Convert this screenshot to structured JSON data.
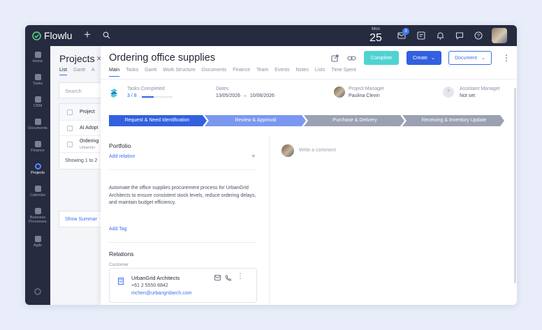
{
  "app": {
    "name": "Flowlu"
  },
  "topbar": {
    "date_month": "Mon",
    "date_day": "25",
    "notification_count": "3"
  },
  "sidebar": {
    "items": [
      {
        "label": "Home",
        "icon": "home-icon"
      },
      {
        "label": "Tasks",
        "icon": "tasks-icon"
      },
      {
        "label": "CRM",
        "icon": "crm-icon"
      },
      {
        "label": "Documents",
        "icon": "documents-icon"
      },
      {
        "label": "Finance",
        "icon": "finance-icon"
      },
      {
        "label": "Projects",
        "icon": "projects-icon"
      },
      {
        "label": "Calendar",
        "icon": "calendar-icon"
      },
      {
        "label": "Business Processes",
        "icon": "business-processes-icon"
      },
      {
        "label": "Agile",
        "icon": "agile-icon"
      }
    ]
  },
  "projects_panel": {
    "title": "Projects",
    "tabs": [
      "List",
      "Gantt",
      "A"
    ],
    "search_placeholder": "Search",
    "column_header": "Project",
    "rows": [
      {
        "name": "AI Adopt",
        "sub": ""
      },
      {
        "name": "Ordering",
        "sub": "UrbanGri"
      }
    ],
    "footer": "Showing 1 to 2",
    "show_summary": "Show Summar"
  },
  "project": {
    "title": "Ordering office supplies",
    "buttons": {
      "complete": "Complete",
      "create": "Create",
      "document": "Document"
    },
    "tabs": [
      "Main",
      "Tasks",
      "Gantt",
      "Work Structure",
      "Documents",
      "Finance",
      "Team",
      "Events",
      "Notes",
      "Lists",
      "Time Spent"
    ],
    "stats": {
      "tasks_label": "Tasks Completed",
      "tasks_value": "3 / 8",
      "tasks_progress": 0.375,
      "dates_label": "Dates",
      "dates_start": "13/05/2026",
      "dates_sep": "–",
      "dates_end": "10/06/2026",
      "pm_label": "Project Manager",
      "pm_value": "Paulina Clevin",
      "am_label": "Assistant Manager",
      "am_value": "Not set"
    },
    "stages": [
      {
        "label": "Request & Need Identification",
        "color": "#3260e0"
      },
      {
        "label": "Review & Approval",
        "color": "#7a98f0"
      },
      {
        "label": "Purchase & Delivery",
        "color": "#9aa1b2"
      },
      {
        "label": "Receiving & Inventory Update",
        "color": "#9aa1b2"
      }
    ],
    "portfolio_title": "Portfolio",
    "add_relation": "Add relation",
    "description": "Automate the office supplies procurement process for UrbanGrid Architects to ensure consistent stock levels, reduce ordering delays, and maintain budget efficiency.",
    "add_tag": "Add Tag",
    "relations_title": "Relations",
    "customer_label": "Customer",
    "customer": {
      "name": "UrbanGrid Architects",
      "phone": "+61 2 5550 8842",
      "email": "mchen@urbangridarch.com"
    },
    "comment_placeholder": "Write a comment"
  },
  "colors": {
    "accent": "#3260e0",
    "complete": "#4fd3d1",
    "sidebar_bg": "#262b40"
  }
}
